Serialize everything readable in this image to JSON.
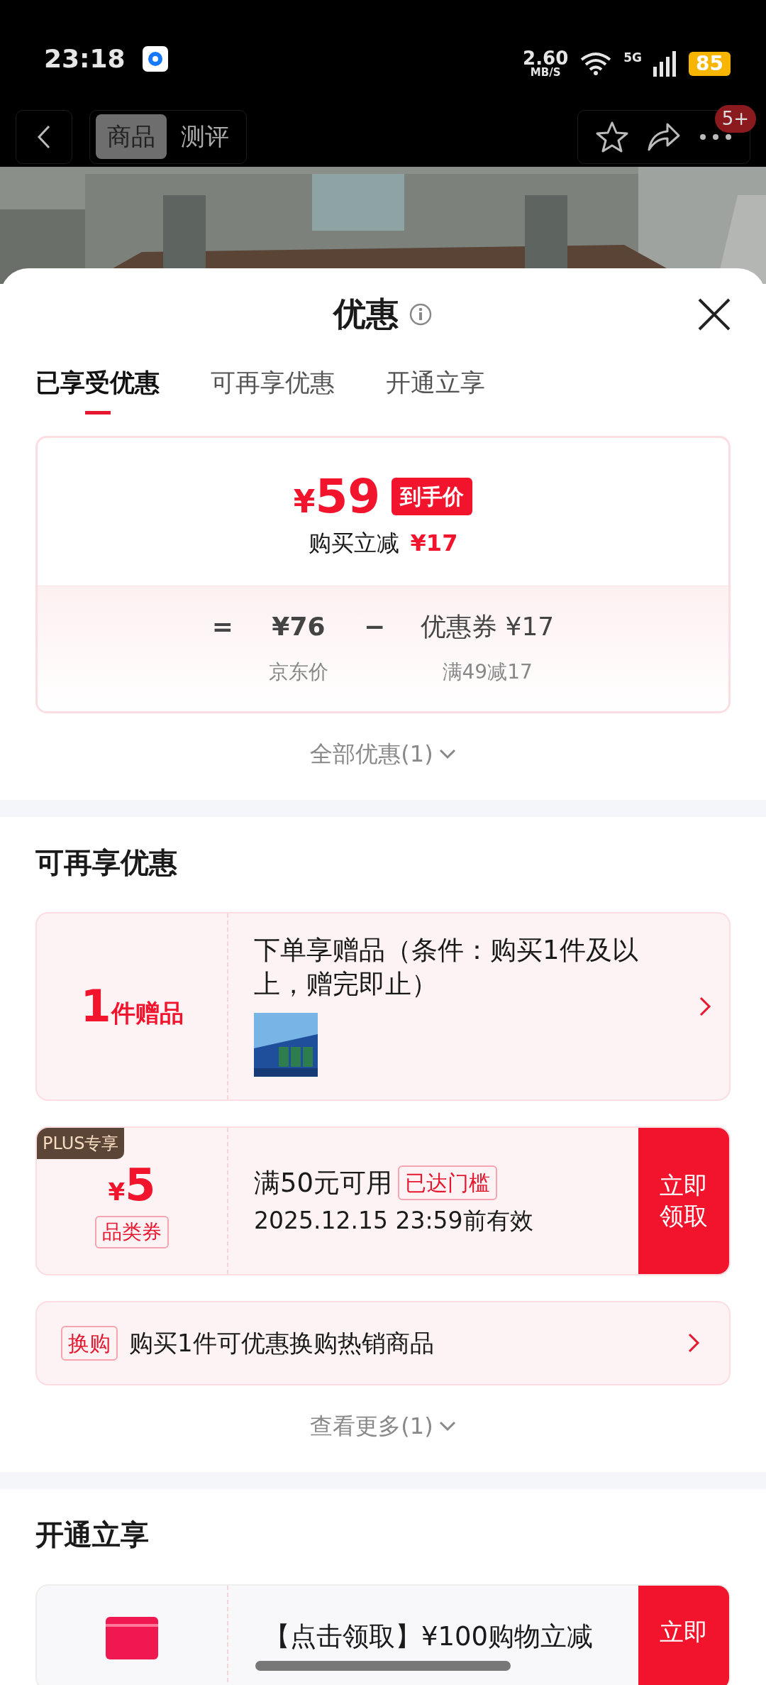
{
  "status_bar": {
    "time": "23:18",
    "speed": "2.60",
    "speed_unit": "MB/S",
    "network": "5G",
    "battery": "85"
  },
  "nav": {
    "tabs": [
      {
        "label": "商品",
        "selected": true
      },
      {
        "label": "测评",
        "selected": false
      }
    ],
    "badge": "5+"
  },
  "sheet": {
    "title": "优惠",
    "tabs": [
      {
        "label": "已享受优惠",
        "selected": true
      },
      {
        "label": "可再享优惠",
        "selected": false
      },
      {
        "label": "开通立享",
        "selected": false
      }
    ],
    "price_card": {
      "price_symbol": "¥",
      "price": "59",
      "price_tag": "到手价",
      "saving_label": "购买立减",
      "saving": "¥17",
      "equals": "=",
      "base_price": "¥76",
      "base_label": "京东价",
      "minus": "−",
      "coupon": "优惠券 ¥17",
      "coupon_rule": "满49减17"
    },
    "all_link": "全部优惠(1)"
  },
  "more_section": {
    "title": "可再享优惠",
    "gift": {
      "count": "1",
      "unit": "件赠品",
      "text": "下单享赠品（条件：购买1件及以上，赠完即止）"
    },
    "coupon": {
      "tag": "PLUS专享",
      "symbol": "¥",
      "amount": "5",
      "type": "品类券",
      "condition": "满50元可用",
      "status": "已达门槛",
      "validity": "2025.12.15 23:59前有效",
      "button": "立即领取"
    },
    "exchange": {
      "tag": "换购",
      "text": "购买1件可优惠换购热销商品"
    },
    "more_link": "查看更多(1)"
  },
  "open_section": {
    "title": "开通立享",
    "offer": {
      "text": "【点击领取】¥100购物立减",
      "button": "立即"
    }
  }
}
